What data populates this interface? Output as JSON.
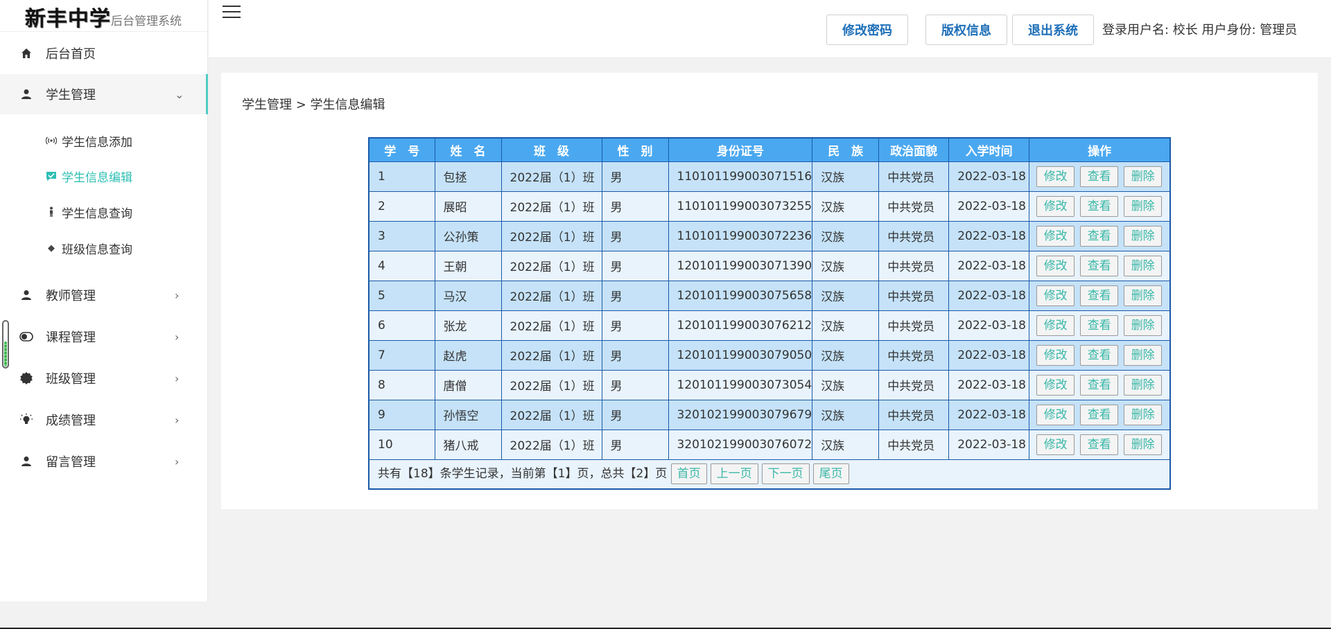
{
  "sidebar": {
    "logo_school": "新丰中学",
    "logo_system": "后台管理系统",
    "items": [
      {
        "label": "后台首页",
        "icon": "home-icon"
      },
      {
        "label": "学生管理",
        "icon": "user-icon"
      },
      {
        "label": "教师管理",
        "icon": "user-icon"
      },
      {
        "label": "课程管理",
        "icon": "toggle-icon"
      },
      {
        "label": "班级管理",
        "icon": "badge-icon"
      },
      {
        "label": "成绩管理",
        "icon": "bulb-icon"
      },
      {
        "label": "留言管理",
        "icon": "user-icon"
      }
    ],
    "sub_items": [
      {
        "label": "学生信息添加",
        "icon": "broadcast-icon"
      },
      {
        "label": "学生信息编辑",
        "icon": "edit-icon"
      },
      {
        "label": "学生信息查询",
        "icon": "person-icon"
      },
      {
        "label": "班级信息查询",
        "icon": "diamond-icon"
      }
    ]
  },
  "header": {
    "btn_change_password": "修改密码",
    "btn_copyright": "版权信息",
    "btn_logout": "退出系统",
    "user_info": "登录用户名:  校长  用户身份:  管理员"
  },
  "breadcrumb": "学生管理 > 学生信息编辑",
  "table": {
    "columns": [
      "学　号",
      "姓　名",
      "班　级",
      "性　别",
      "身份证号",
      "民　族",
      "政治面貌",
      "入学时间",
      "操作"
    ],
    "op_labels": [
      "修改",
      "查看",
      "删除"
    ],
    "rows": [
      [
        "1",
        "包拯",
        "2022届（1）班",
        "男",
        "110101199003071516",
        "汉族",
        "中共党员",
        "2022-03-18"
      ],
      [
        "2",
        "展昭",
        "2022届（1）班",
        "男",
        "110101199003073255",
        "汉族",
        "中共党员",
        "2022-03-18"
      ],
      [
        "3",
        "公孙策",
        "2022届（1）班",
        "男",
        "110101199003072236",
        "汉族",
        "中共党员",
        "2022-03-18"
      ],
      [
        "4",
        "王朝",
        "2022届（1）班",
        "男",
        "120101199003071390",
        "汉族",
        "中共党员",
        "2022-03-18"
      ],
      [
        "5",
        "马汉",
        "2022届（1）班",
        "男",
        "120101199003075658",
        "汉族",
        "中共党员",
        "2022-03-18"
      ],
      [
        "6",
        "张龙",
        "2022届（1）班",
        "男",
        "120101199003076212",
        "汉族",
        "中共党员",
        "2022-03-18"
      ],
      [
        "7",
        "赵虎",
        "2022届（1）班",
        "男",
        "120101199003079050",
        "汉族",
        "中共党员",
        "2022-03-18"
      ],
      [
        "8",
        "唐僧",
        "2022届（1）班",
        "男",
        "120101199003073054",
        "汉族",
        "中共党员",
        "2022-03-18"
      ],
      [
        "9",
        "孙悟空",
        "2022届（1）班",
        "男",
        "320102199003079679",
        "汉族",
        "中共党员",
        "2022-03-18"
      ],
      [
        "10",
        "猪八戒",
        "2022届（1）班",
        "男",
        "320102199003076072",
        "汉族",
        "中共党员",
        "2022-03-18"
      ]
    ],
    "footer_text": "共有【18】条学生记录，当前第【1】页，总共【2】页",
    "pagination": [
      "首页",
      "上一页",
      "下一页",
      "尾页"
    ]
  }
}
